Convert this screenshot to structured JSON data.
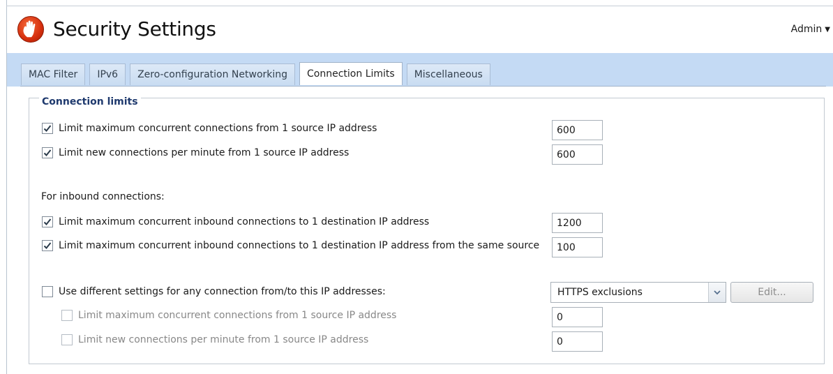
{
  "header": {
    "title": "Security Settings",
    "user_menu": "Admin"
  },
  "tabs": [
    {
      "label": "MAC Filter",
      "active": false
    },
    {
      "label": "IPv6",
      "active": false
    },
    {
      "label": "Zero-configuration Networking",
      "active": false
    },
    {
      "label": "Connection Limits",
      "active": true
    },
    {
      "label": "Miscellaneous",
      "active": false
    }
  ],
  "connection_limits": {
    "legend": "Connection limits",
    "max_concurrent": {
      "label": "Limit maximum concurrent connections from 1 source IP address",
      "checked": true,
      "value": "600"
    },
    "new_per_minute": {
      "label": "Limit new connections per minute from 1 source IP address",
      "checked": true,
      "value": "600"
    },
    "inbound_heading": "For inbound connections:",
    "inbound_max_concurrent": {
      "label": "Limit maximum concurrent inbound connections to 1 destination IP address",
      "checked": true,
      "value": "1200"
    },
    "inbound_same_source": {
      "label": "Limit maximum concurrent inbound connections to 1 destination IP address from the same source",
      "checked": true,
      "value": "100"
    },
    "different_settings": {
      "label": "Use different settings for any connection from/to this IP addresses:",
      "checked": false
    },
    "ip_group_select": {
      "value": "HTTPS exclusions"
    },
    "edit_button": "Edit...",
    "sub_max_concurrent": {
      "label": "Limit maximum concurrent connections from 1 source IP address",
      "checked": false,
      "value": "0"
    },
    "sub_new_per_minute": {
      "label": "Limit new connections per minute from 1 source IP address",
      "checked": false,
      "value": "0"
    }
  },
  "colors": {
    "accent_band": "#c4daf4",
    "legend_text": "#1f3a6e",
    "icon_red": "#d62f0e"
  },
  "icons": {
    "app": "stop-hand-icon",
    "check": "checkmark-icon",
    "caret": "chevron-down-icon"
  }
}
